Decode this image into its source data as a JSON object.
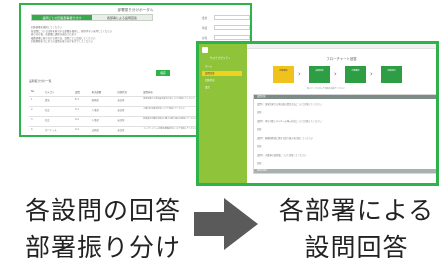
{
  "left_screen": {
    "title": "部署振り分けポータル",
    "tabs": [
      "設問ごとの回答部署振り分け",
      "各部署による設問回答"
    ],
    "description_lines": [
      "回答部署を選択してください",
      "各設問について回答を担当する部署を選択し、保存ボタンを押してください",
      "振り分け後、各部署に通知が送信されます",
      "複数部署に振り分ける場合は、設問ごとに追加してください",
      "回答期限までに全ての設問の振り分けを完了してください"
    ],
    "fields": [
      {
        "label": "会社",
        "value": ""
      },
      {
        "label": "年度",
        "value": ""
      },
      {
        "label": "担当",
        "value": ""
      }
    ],
    "save_button": "保存",
    "section_label": "設問振り分け一覧",
    "table": {
      "headers": [
        "No",
        "カテゴリ",
        "設問",
        "担当部署",
        "回答状況",
        "設問内容"
      ],
      "rows": [
        [
          "1",
          "環境",
          "E-1",
          "総務部",
          "未回答",
          "温室効果ガス排出量の算定方法について回答してください"
        ],
        [
          "2",
          "社会",
          "S-1",
          "人事部",
          "未回答",
          "人権方針の策定状況について回答してください"
        ],
        [
          "3",
          "社会",
          "S-2",
          "人事部",
          "未回答",
          "従業員の労働安全衛生に関する取り組みを回答してください"
        ],
        [
          "4",
          "ガバナンス",
          "G-1",
          "法務部",
          "未回答",
          "コンプライアンス体制の整備状況について回答してください"
        ]
      ]
    }
  },
  "right_screen": {
    "sidebar": {
      "logo_text": "サステナビリティ",
      "items": [
        "ホーム",
        "設問回答",
        "回答状況",
        "設定"
      ]
    },
    "title": "フローチャート回答",
    "steps": [
      "回答開始",
      "設問回答",
      "内容確認",
      "回答提出"
    ],
    "subnote": "各ステップに沿って回答を進めてください",
    "box": {
      "header": "設問回答",
      "lines": [
        "設問1：温室効果ガス排出量の算定方法について回答してください",
        "回答：",
        "設問2：再生可能エネルギーの導入状況について回答してください",
        "回答：",
        "設問3：廃棄物削減に関する取り組みを回答してください",
        "回答：",
        "設問4：水資源の使用量について回答してください",
        "回答："
      ],
      "footer": "回答を保存"
    }
  },
  "captions": {
    "left": [
      "各設問の回答",
      "部署振り分け"
    ],
    "right": [
      "各部署による",
      "設問回答"
    ]
  },
  "colors": {
    "accent_green": "#2eb34a",
    "sidebar_green": "#8fc43a",
    "highlight_yellow": "#f0d21e",
    "arrow_gray": "#5a5a5a"
  }
}
